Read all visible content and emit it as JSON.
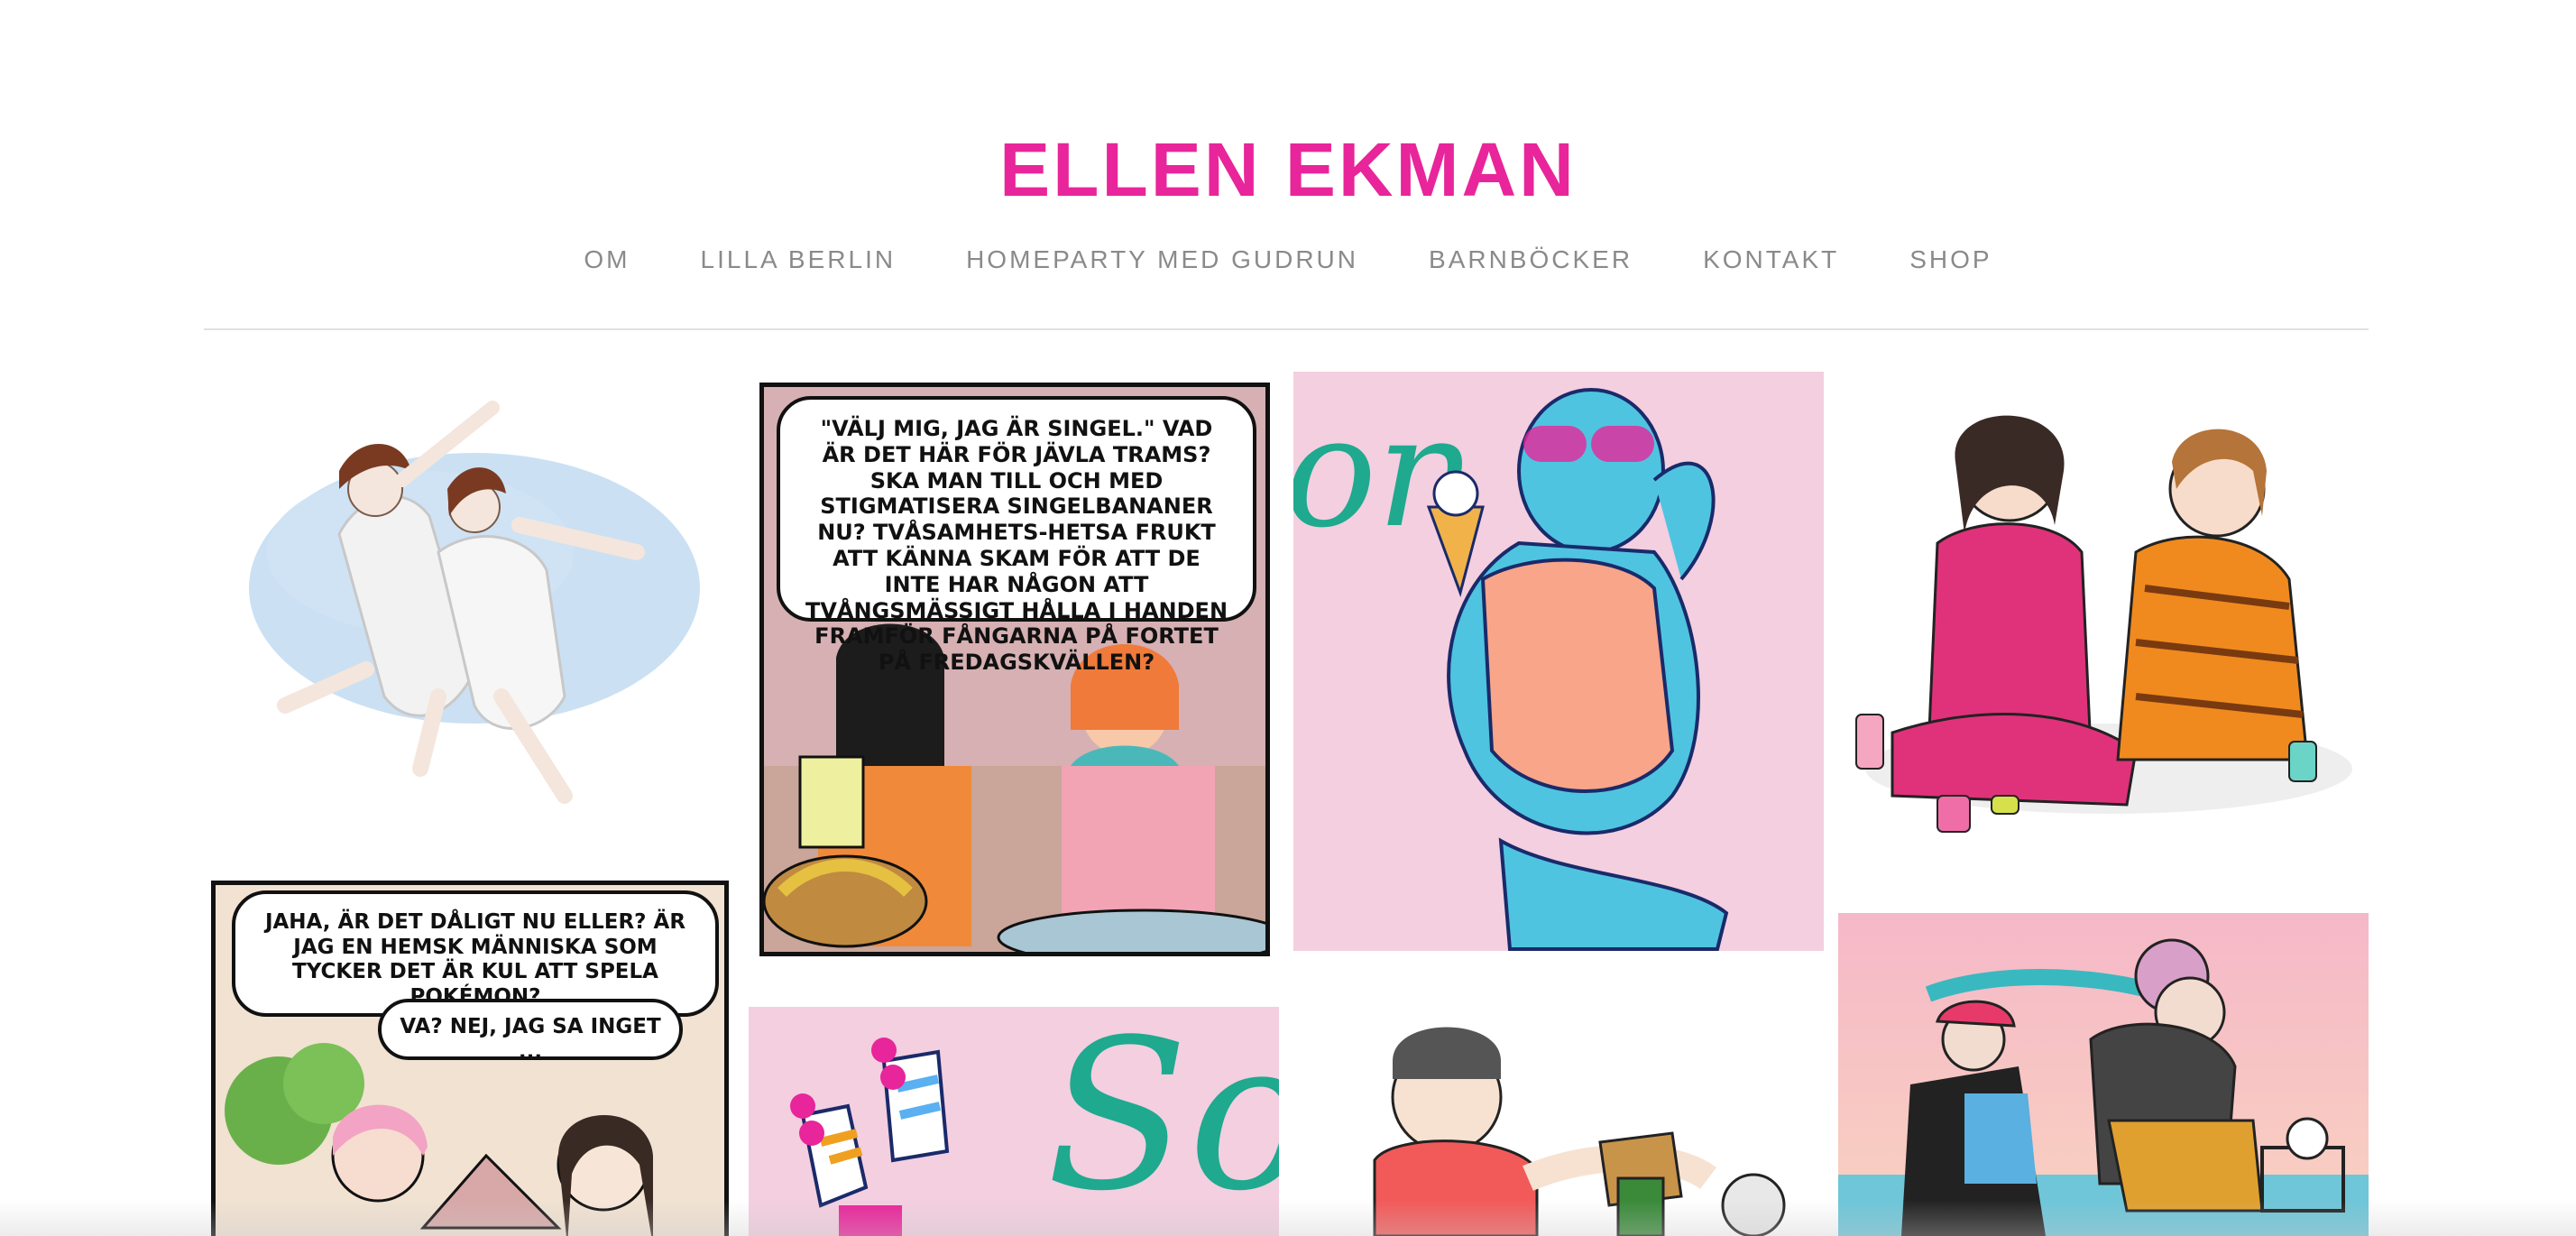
{
  "site": {
    "title": "ELLEN EKMAN"
  },
  "nav": {
    "items": [
      "OM",
      "LILLA BERLIN",
      "HOMEPARTY MED GUDRUN",
      "BARNBÖCKER",
      "KONTAKT",
      "SHOP"
    ]
  },
  "gallery": {
    "tiles": [
      {
        "name": "angels-illustration"
      },
      {
        "name": "singel-comic",
        "bubble": "\"VÄLJ MIG, JAG ÄR SINGEL.\" VAD ÄR DET HÄR FÖR JÄVLA TRAMS? SKA MAN TILL OCH MED STIGMATISERA SINGELBANANER NU? TVÅSAMHETS-HETSA FRUKT ATT KÄNNA SKAM FÖR ATT DE INTE HAR NÅGON ATT TVÅNGSMÄSSIGT HÅLLA I HANDEN FRAMFÖR FÅNGARNA PÅ FORTET PÅ FREDAGSKVÄLLEN?"
      },
      {
        "name": "swimsuit-icecream-illustration",
        "lettering": "on"
      },
      {
        "name": "nail-polish-illustration"
      },
      {
        "name": "pokemon-comic",
        "bubble1": "JAHA, ÄR DET DÅLIGT NU ELLER? ÄR JAG EN HEMSK MÄNNISKA SOM TYCKER DET ÄR KUL ATT SPELA POKÉMON?",
        "bubble2": "VA? NEJ, JAG SA INGET ..."
      },
      {
        "name": "rollerskates-illustration",
        "lettering": "So"
      },
      {
        "name": "sofa-snack-illustration"
      },
      {
        "name": "bike-ride-illustration"
      }
    ]
  },
  "colors": {
    "brand": "#e8259a",
    "nav_text": "#8a8a8a",
    "tile_pink": "#f3cfe0",
    "teal": "#1fa98e",
    "blue_figure": "#4fc4e0"
  }
}
